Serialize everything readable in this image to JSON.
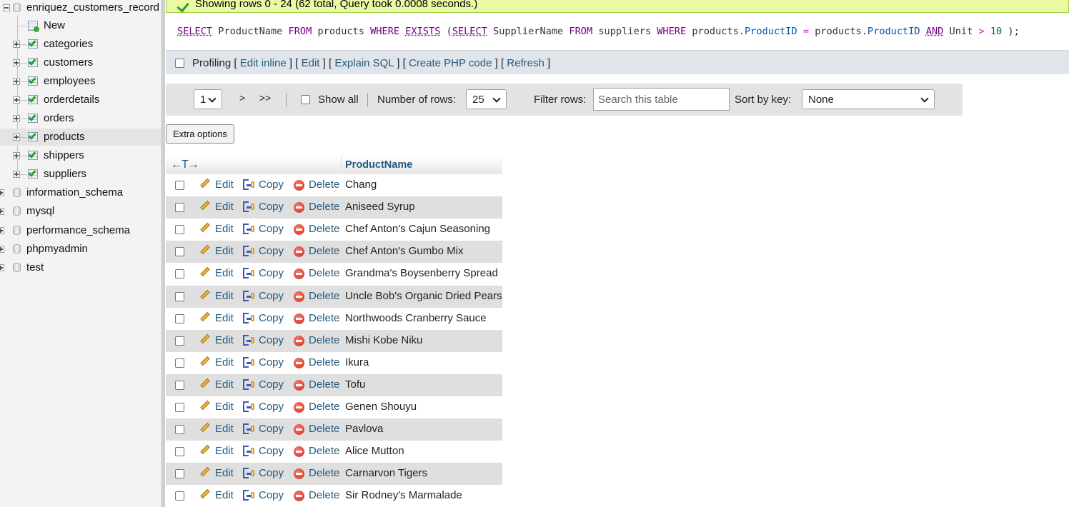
{
  "nav": {
    "database": "enriquez_customers_record",
    "new_label": "New",
    "tables": [
      "categories",
      "customers",
      "employees",
      "orderdetails",
      "orders",
      "products",
      "shippers",
      "suppliers"
    ],
    "selected_table": "products",
    "other_databases": [
      "information_schema",
      "mysql",
      "performance_schema",
      "phpmyadmin",
      "test"
    ]
  },
  "status": {
    "message": "Showing rows 0 - 24 (62 total, Query took 0.0008 seconds.)"
  },
  "query": {
    "sql": "SELECT ProductName FROM products WHERE EXISTS (SELECT SupplierName FROM suppliers WHERE products.ProductID = products.ProductID AND Unit > 10 );"
  },
  "tools": {
    "profiling": "Profiling",
    "edit_inline": "Edit inline",
    "edit": "Edit",
    "explain_sql": "Explain SQL",
    "create_php": "Create PHP code",
    "refresh": "Refresh"
  },
  "navigation": {
    "page": "1",
    "next": ">",
    "last": ">>",
    "show_all": "Show all",
    "rows_label": "Number of rows:",
    "rows_value": "25",
    "filter_label": "Filter rows:",
    "filter_placeholder": "Search this table",
    "sort_label": "Sort by key:",
    "sort_value": "None"
  },
  "extra_options": "Extra options",
  "table": {
    "column": "ProductName",
    "arrows": "←T→",
    "actions": {
      "edit": "Edit",
      "copy": "Copy",
      "delete": "Delete"
    },
    "rows": [
      "Chang",
      "Aniseed Syrup",
      "Chef Anton's Cajun Seasoning",
      "Chef Anton's Gumbo Mix",
      "Grandma's Boysenberry Spread",
      "Uncle Bob's Organic Dried Pears",
      "Northwoods Cranberry Sauce",
      "Mishi Kobe Niku",
      "Ikura",
      "Tofu",
      "Genen Shouyu",
      "Pavlova",
      "Alice Mutton",
      "Carnarvon Tigers",
      "Sir Rodney's Marmalade"
    ]
  }
}
